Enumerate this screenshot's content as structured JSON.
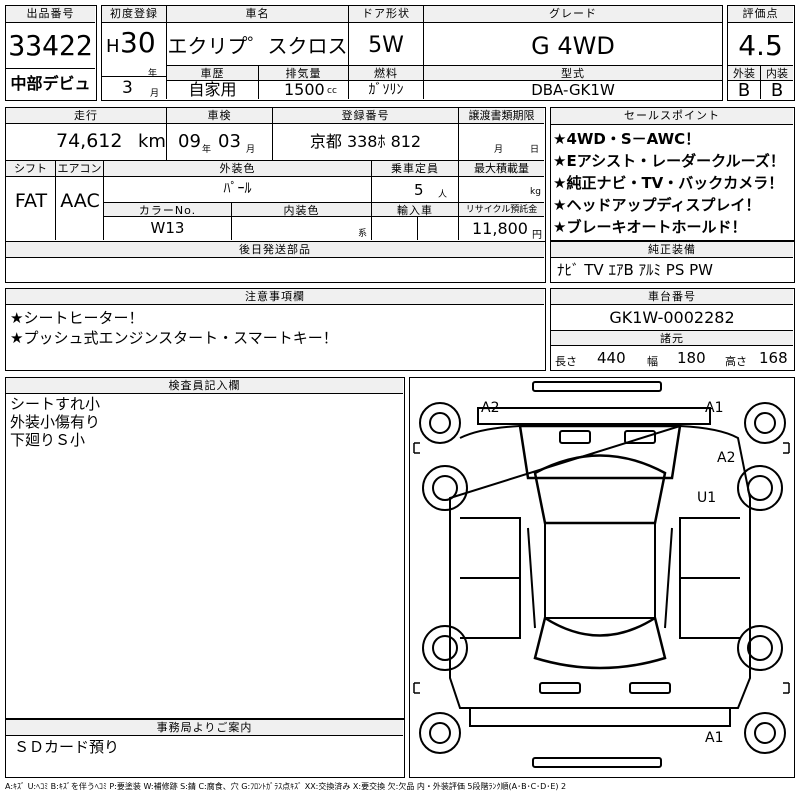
{
  "header": {
    "lot_no_label": "出品番号",
    "lot_no": "33422",
    "debut_note": "中部デビュ",
    "first_reg_label": "初度登録",
    "era": "H",
    "year": "30",
    "year_unit": "年",
    "month": "3",
    "month_unit": "月",
    "car_name_label": "車名",
    "car_name": "エクリプ゜スクロス",
    "door_label": "ドア形状",
    "door": "5W",
    "grade_label": "グレード",
    "grade": "G 4WD",
    "score_label": "評価点",
    "score": "4.5",
    "history_label": "車歴",
    "history": "自家用",
    "displacement_label": "排気量",
    "displacement": "1500",
    "displacement_unit": "cc",
    "fuel_label": "燃料",
    "fuel": "ｶﾞｿﾘﾝ",
    "model_label": "型式",
    "model": "DBA-GK1W",
    "exterior_label": "外装",
    "exterior": "B",
    "interior_label": "内装",
    "interior": "B"
  },
  "specs": {
    "mileage_label": "走行",
    "mileage": "74,612",
    "mileage_unit": "km",
    "inspection_label": "車検",
    "inspection_year": "09",
    "inspection_year_unit": "年",
    "inspection_month": "03",
    "inspection_month_unit": "月",
    "plate_label": "登録番号",
    "plate": "京都 338ﾎ 812",
    "transfer_label": "譲渡書類期限",
    "transfer_month_unit": "月",
    "transfer_day_unit": "日",
    "shift_label": "シフト",
    "shift": "FAT",
    "ac_label": "エアコン",
    "ac": "AAC",
    "color_label": "外装色",
    "color": "ﾊﾟｰﾙ",
    "capacity_label": "乗車定員",
    "capacity": "5",
    "capacity_unit": "人",
    "load_label": "最大積載量",
    "load_unit": "kg",
    "color_no_label": "カラーNo.",
    "color_no": "W13",
    "interior_color_label": "内装色",
    "interior_color_unit": "系",
    "import_label": "輸入車",
    "recycle_label": "リサイクル預託金",
    "recycle": "11,800",
    "recycle_unit": "円",
    "later_parts_label": "後日発送部品"
  },
  "sales_points": {
    "label": "セールスポイント",
    "items": [
      "★4WD・S－AWC！",
      "★Eアシスト・レーダークルーズ！",
      "★純正ナビ・TV・バックカメラ！",
      "★ヘッドアップディスプレイ！",
      "★ブレーキオートホールド！"
    ]
  },
  "equipment": {
    "label": "純正装備",
    "value": "ﾅﾋﾞ TV ｴｱB ｱﾙﾐ PS PW"
  },
  "notes": {
    "label": "注意事項欄",
    "items": [
      "★シートヒーター！",
      "★プッシュ式エンジンスタート・スマートキー！"
    ]
  },
  "chassis": {
    "label": "車台番号",
    "value": "GK1W-0002282",
    "dims_label": "諸元",
    "length_label": "長さ",
    "length": "440",
    "width_label": "幅",
    "width": "180",
    "height_label": "高さ",
    "height": "168"
  },
  "inspector": {
    "label": "検査員記入欄",
    "lines": [
      "シートすれ小",
      "外装小傷有り",
      "下廻りＳ小"
    ]
  },
  "office": {
    "label": "事務局よりご案内",
    "text": "ＳＤカード預り"
  },
  "diagram": {
    "marks": [
      "A2",
      "A1",
      "A2",
      "U1",
      "A1"
    ]
  },
  "legend": "A:ｷｽﾞ U:ﾍｺﾐ B:ｷｽﾞを伴うﾍｺﾐ P:要塗装 W:補修跡 S:錆 C:腐食、穴 G:ﾌﾛﾝﾄｶﾞﾗｽ点ｷｽﾞ XX:交換済み X:要交換 欠:欠品 内・外装評価 5段階ﾗﾝｸ順(A･B･C･D･E) 2"
}
